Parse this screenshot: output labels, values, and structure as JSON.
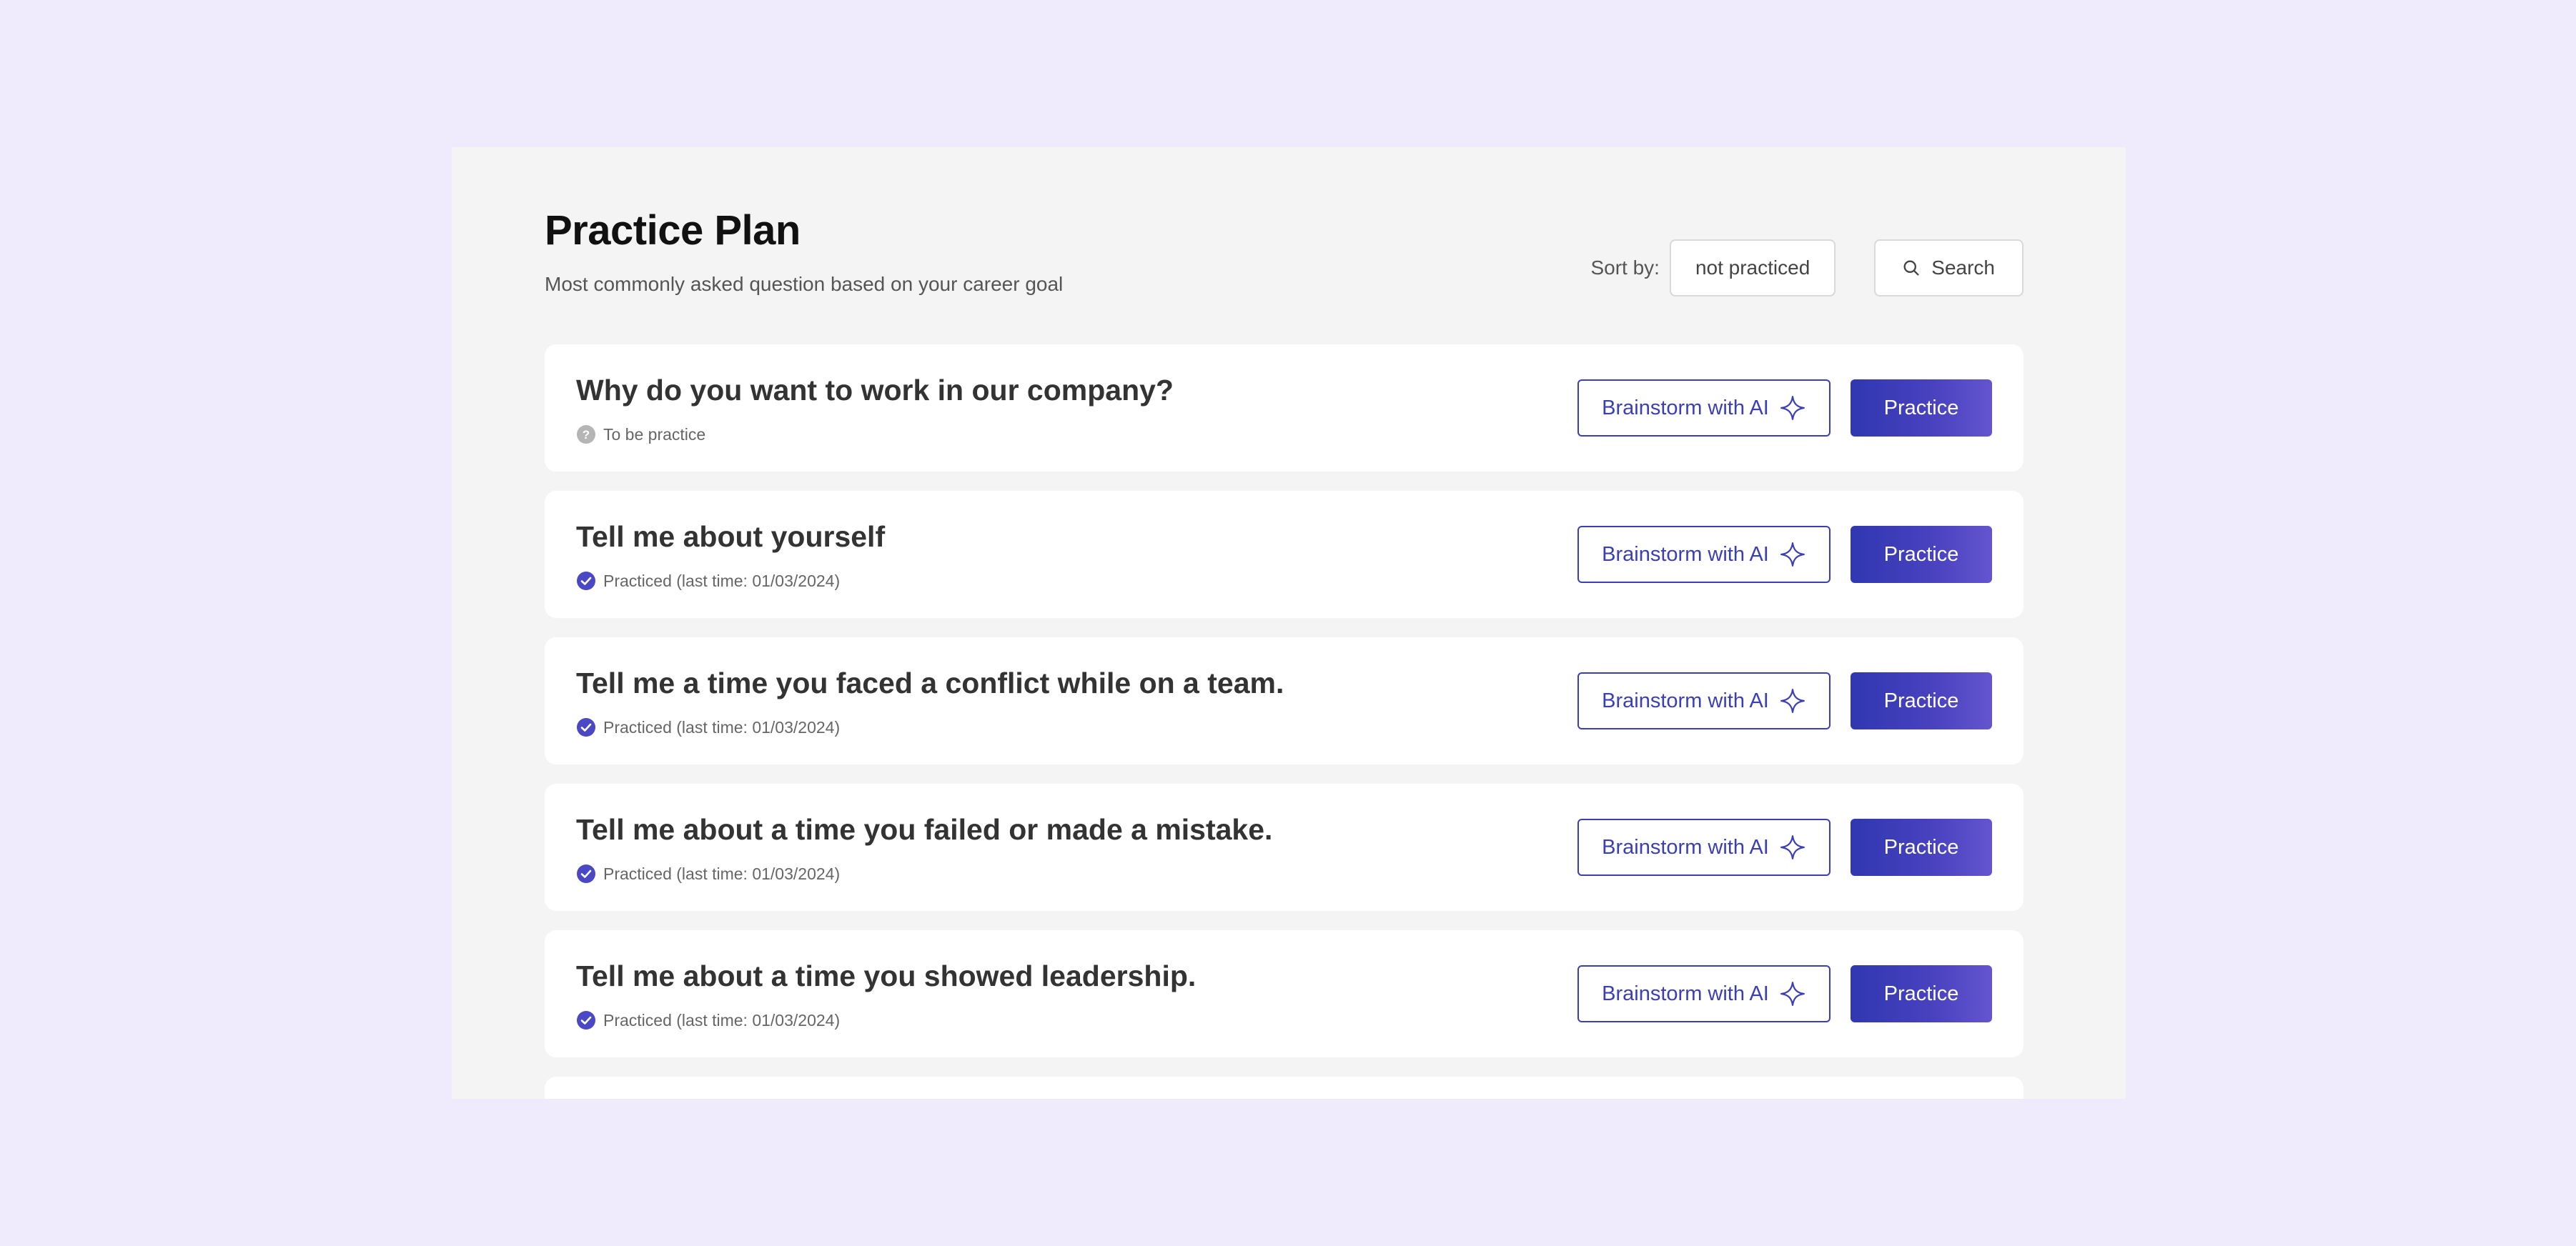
{
  "header": {
    "title": "Practice Plan",
    "subtitle": "Most commonly asked question based on your career goal"
  },
  "controls": {
    "sort_label": "Sort by:",
    "sort_value": "not practiced",
    "search_label": "Search",
    "search_icon": "search-icon"
  },
  "questions": [
    {
      "title": "Why do you want to work in our company?",
      "status": "To be practice",
      "status_icon": "question-icon",
      "brainstorm_label": "Brainstorm with AI",
      "practice_label": "Practice"
    },
    {
      "title": "Tell me about yourself",
      "status": "Practiced (last time: 01/03/2024)",
      "status_icon": "check-icon",
      "brainstorm_label": "Brainstorm with AI",
      "practice_label": "Practice"
    },
    {
      "title": "Tell me a time you faced a conflict while on a team.",
      "status": "Practiced (last time: 01/03/2024)",
      "status_icon": "check-icon",
      "brainstorm_label": "Brainstorm with AI",
      "practice_label": "Practice"
    },
    {
      "title": "Tell me about a time you failed or made a mistake.",
      "status": "Practiced (last time: 01/03/2024)",
      "status_icon": "check-icon",
      "brainstorm_label": "Brainstorm with AI",
      "practice_label": "Practice"
    },
    {
      "title": "Tell me about a time you showed leadership.",
      "status": "Practiced (last time: 01/03/2024)",
      "status_icon": "check-icon",
      "brainstorm_label": "Brainstorm with AI",
      "practice_label": "Practice"
    }
  ],
  "colors": {
    "page_background": "#efebfd",
    "panel_background": "#f4f4f4",
    "accent": "#3b3fb6",
    "check": "#4a48c4",
    "pending": "#b5b5b5"
  }
}
